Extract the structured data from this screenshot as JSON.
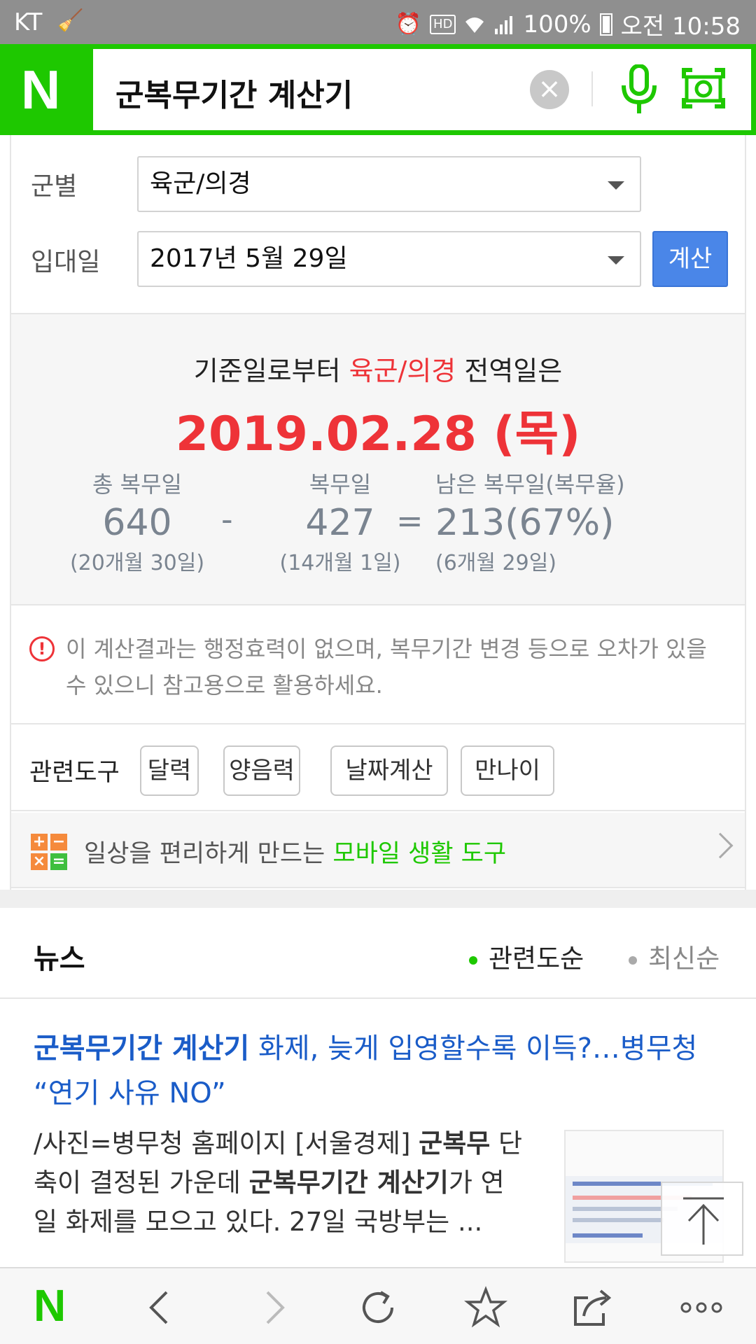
{
  "status_bar": {
    "carrier": "KT",
    "battery": "100%",
    "time": "오전 10:58"
  },
  "search": {
    "query": "군복무기간 계산기",
    "brand_color": "#1ec800"
  },
  "calculator": {
    "branch_label": "군별",
    "branch_value": "육군/의경",
    "enlist_label": "입대일",
    "enlist_value": "2017년 5월 29일",
    "calc_button": "계산",
    "result": {
      "prefix": "기준일로부터",
      "branch": "육군/의경",
      "suffix": "전역일은",
      "end_date": "2019.02.28 (목)",
      "total_label": "총 복무일",
      "total_days": "640",
      "total_sub": "(20개월 30일)",
      "minus": "-",
      "served_label": "복무일",
      "served_days": "427",
      "served_sub": "(14개월 1일)",
      "equals": "=",
      "remain_label": "남은 복무일(복무율)",
      "remain_days": "213(67%)",
      "remain_sub": "(6개월 29일)"
    },
    "notice": "이 계산결과는 행정효력이 없으며, 복무기간 변경 등으로 오차가 있을 수 있으니 참고용으로 활용하세요.",
    "tools_label": "관련도구",
    "tools": [
      "달력",
      "양음력",
      "날짜계산",
      "만나이"
    ],
    "mobile_prefix": "일상을 편리하게 만드는",
    "mobile_link": "모바일 생활 도구"
  },
  "news": {
    "title": "뉴스",
    "sort_relevance": "관련도순",
    "sort_latest": "최신순",
    "item": {
      "headline_bold": "군복무기간 계산기",
      "headline_rest": " 화제, 늦게 입영할수록 이득?…병무청 “연기 사유 NO”",
      "body_1": "/사진=병무청 홈페이지 [서울경제] ",
      "body_bold_1": "군복무",
      "body_2": " 단축이 결정된 가운데 ",
      "body_bold_2": "군복무기간 계산기",
      "body_3": "가 연일 화제를 모으고 있다. 27일 국방부는 ..."
    }
  },
  "colors": {
    "accent_red": "#ee3338",
    "link_blue": "#1a5cc8",
    "button_blue": "#4a86e8"
  }
}
